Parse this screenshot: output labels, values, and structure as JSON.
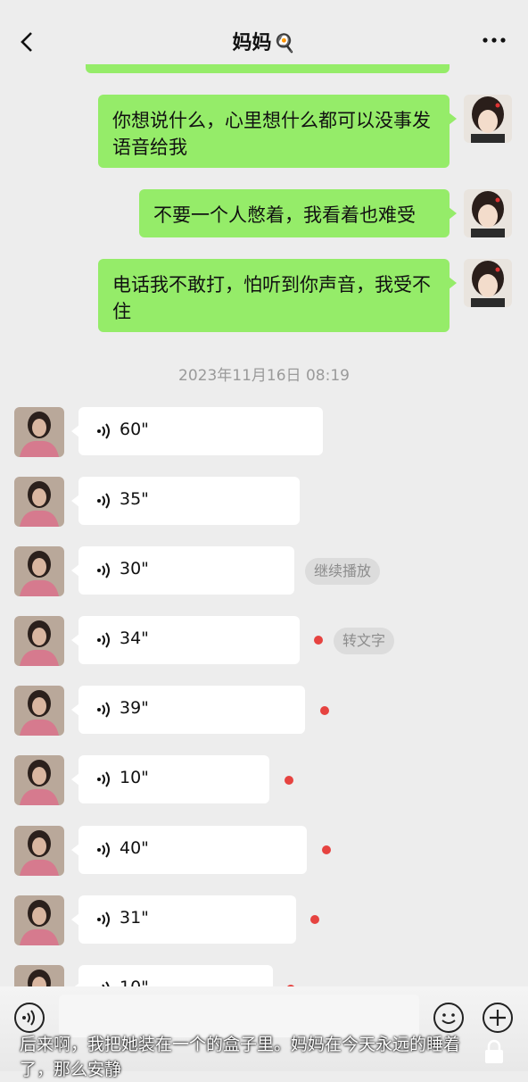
{
  "header": {
    "title": "妈妈",
    "title_emoji": "🍳"
  },
  "messages_out": [
    {
      "text": "你想说什么，心里想什么都可以没事发语音给我"
    },
    {
      "text": "不要一个人憋着，我看着也难受"
    },
    {
      "text": "电话我不敢打，怕听到你声音，我受不住"
    }
  ],
  "timestamp": "2023年11月16日 08:19",
  "voice_messages": [
    {
      "duration": "60\""
    },
    {
      "duration": "35\""
    },
    {
      "duration": "30\"",
      "tag": "继续播放"
    },
    {
      "duration": "34\"",
      "tag": "转文字",
      "unread": true
    },
    {
      "duration": "39\"",
      "unread": true
    },
    {
      "duration": "10\"",
      "unread": true
    },
    {
      "duration": "40\"",
      "unread": true
    },
    {
      "duration": "31\"",
      "unread": true
    },
    {
      "duration": "10\"",
      "unread": true
    }
  ],
  "caption": "后来啊，我把她装在一个的盒子里。妈妈在今天永远的睡着了，那么安静",
  "colors": {
    "bubble_out": "#95ec69",
    "bubble_in": "#ffffff",
    "background": "#ededed",
    "unread_dot": "#e64340"
  },
  "icons": [
    "back-icon",
    "more-icon",
    "voice-input-icon",
    "emoji-icon",
    "plus-icon",
    "lock-icon"
  ]
}
